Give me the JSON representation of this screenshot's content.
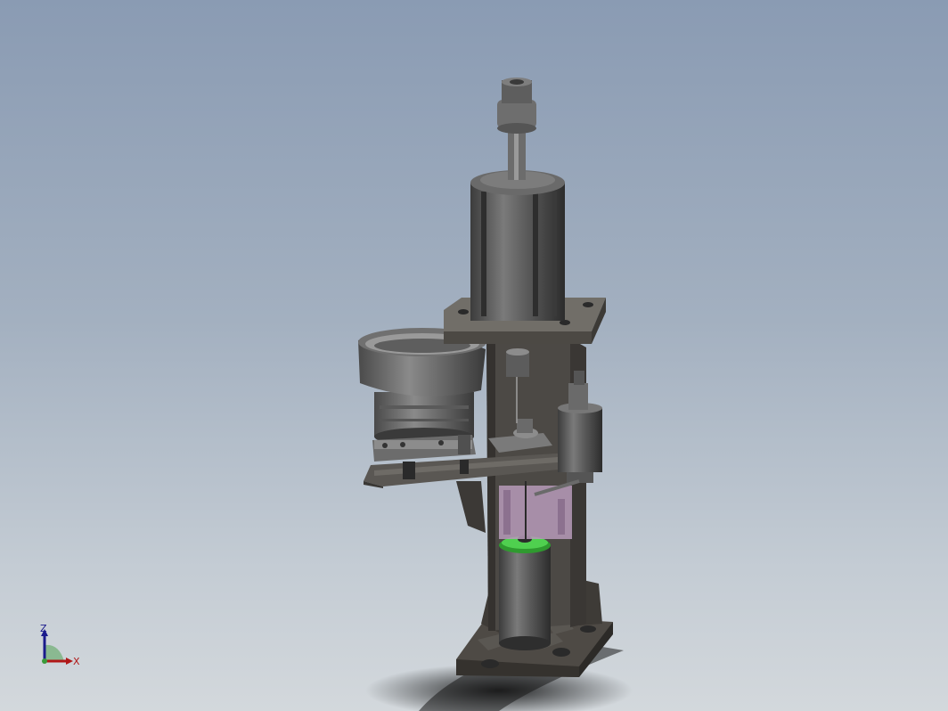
{
  "triad": {
    "z_label": "Z",
    "x_label": "X",
    "colors": {
      "z_axis": "#1a1a8c",
      "x_axis": "#b01818",
      "y_plane": "#3a9a3a"
    }
  },
  "model": {
    "body_color": "#4a4a4a",
    "plate_color": "#6a6a6a",
    "highlight_color": "#3fbf3f",
    "accent_color": "#b79aba"
  }
}
